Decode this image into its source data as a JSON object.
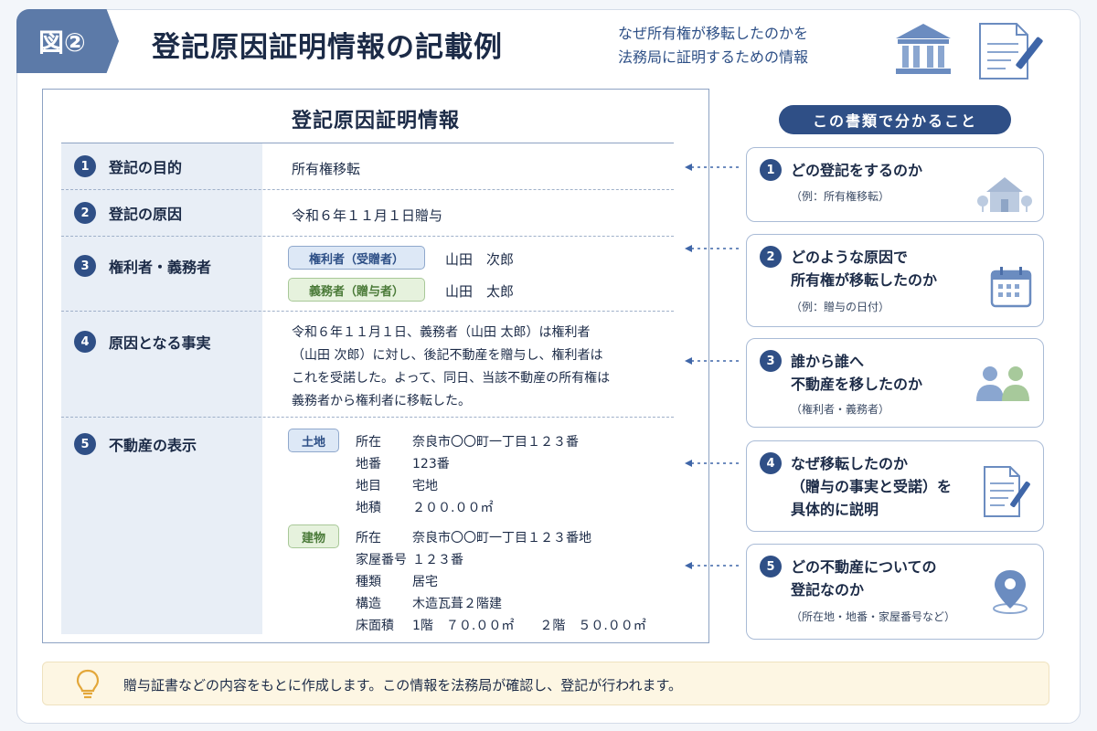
{
  "header": {
    "fig_label": "図②",
    "title": "登記原因証明情報の記載例",
    "subtitle_line1": "なぜ所有権が移転したのかを",
    "subtitle_line2": "法務局に証明するための情報",
    "icons": [
      "courthouse-icon",
      "document-pen-icon"
    ]
  },
  "document": {
    "title": "登記原因証明情報",
    "rows": [
      {
        "num": "1",
        "label": "登記の目的",
        "value": "所有権移転"
      },
      {
        "num": "2",
        "label": "登記の原因",
        "value": "令和６年１１月１日贈与"
      },
      {
        "num": "3",
        "label": "権利者・義務者",
        "right_holder_tag": "権利者（受贈者）",
        "right_holder_name": "山田　次郎",
        "obligor_tag": "義務者（贈与者）",
        "obligor_name": "山田　太郎"
      },
      {
        "num": "4",
        "label": "原因となる事実",
        "lines": [
          "令和６年１１月１日、義務者（山田 太郎）は権利者",
          "（山田 次郎）に対し、後記不動産を贈与し、権利者は",
          "これを受諾した。よって、同日、当該不動産の所有権は",
          "義務者から権利者に移転した。"
        ]
      },
      {
        "num": "5",
        "label": "不動産の表示",
        "land_tag": "土地",
        "land": [
          {
            "k": "所在",
            "v": "奈良市〇〇町一丁目１２３番"
          },
          {
            "k": "地番",
            "v": "123番"
          },
          {
            "k": "地目",
            "v": "宅地"
          },
          {
            "k": "地積",
            "v": "２００.００㎡"
          }
        ],
        "building_tag": "建物",
        "building": [
          {
            "k": "所在",
            "v": "奈良市〇〇町一丁目１２３番地"
          },
          {
            "k": "家屋番号",
            "v": "１２３番"
          },
          {
            "k": "種類",
            "v": "居宅"
          },
          {
            "k": "構造",
            "v": "木造瓦葺２階建"
          },
          {
            "k": "床面積",
            "v": "1階　７０.００㎡　　２階　５０.００㎡"
          }
        ]
      }
    ]
  },
  "side": {
    "heading": "この書類で分かること",
    "cards": [
      {
        "num": "1",
        "line1": "どの登記をするのか",
        "line2": "",
        "note": "（例：所有権移転）",
        "icon": "house-icon"
      },
      {
        "num": "2",
        "line1": "どのような原因で",
        "line2": "所有権が移転したのか",
        "note": "（例：贈与の日付）",
        "icon": "calendar-icon"
      },
      {
        "num": "3",
        "line1": "誰から誰へ",
        "line2": "不動産を移したのか",
        "note": "（権利者・義務者）",
        "icon": "people-icon"
      },
      {
        "num": "4",
        "line1": "なぜ移転したのか",
        "line2": "（贈与の事実と受諾）を",
        "line3": "具体的に説明",
        "note": "",
        "icon": "document-pen-icon"
      },
      {
        "num": "5",
        "line1": "どの不動産についての",
        "line2": "登記なのか",
        "note": "（所在地・地番・家屋番号など）",
        "icon": "location-pin-icon"
      }
    ]
  },
  "footer": {
    "text": "贈与証書などの内容をもとに作成します。この情報を法務局が確認し、登記が行われます。",
    "icon": "lightbulb-icon"
  },
  "colors": {
    "navy": "#2f4f86",
    "label_bg": "#e8eef6",
    "tag_blue": "#dde8f6",
    "tag_green": "#e6f2dd",
    "footer_bg": "#fdf6e3"
  }
}
